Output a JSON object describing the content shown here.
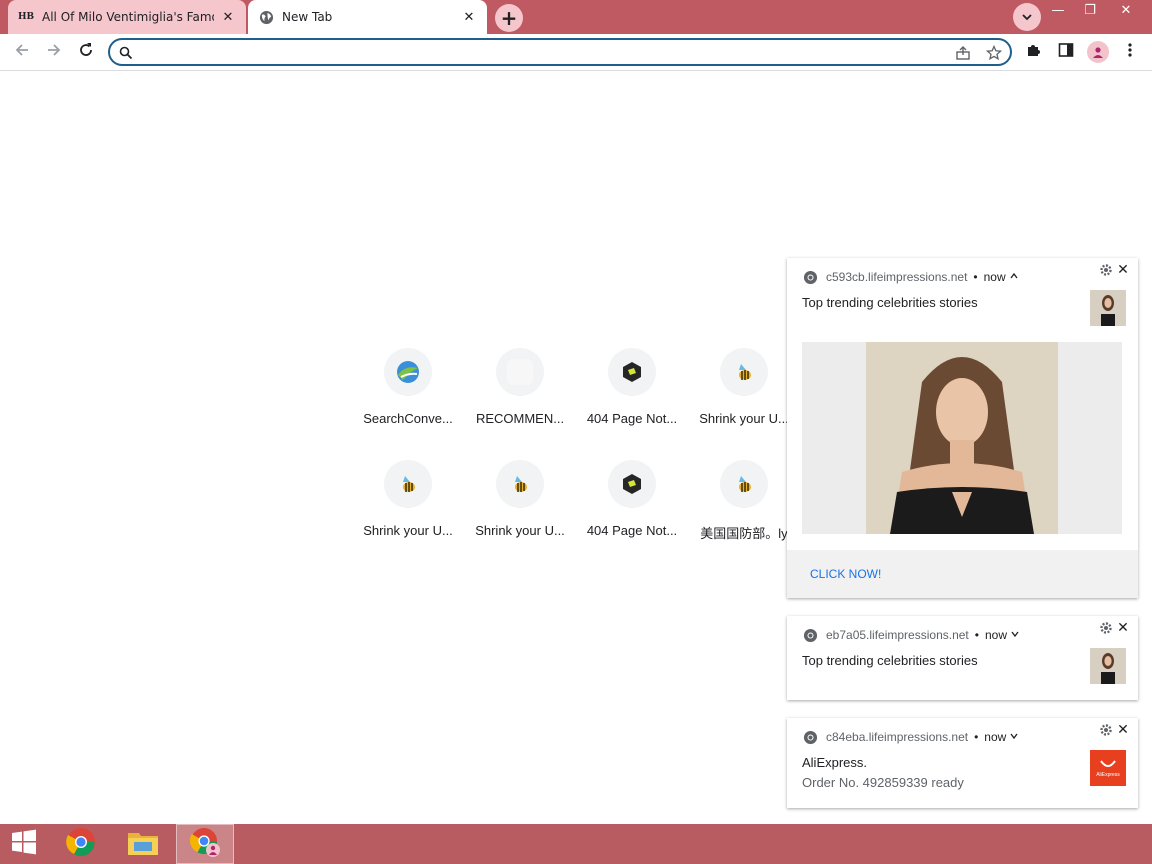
{
  "browser": {
    "tabs": [
      {
        "favicon_text": "HB",
        "title": "All Of Milo Ventimiglia's Famous",
        "close": "✕"
      },
      {
        "favicon_text": "",
        "title": "New Tab",
        "close": "✕"
      }
    ],
    "new_tab": "+",
    "window": {
      "minimize": "—",
      "restore": "❐",
      "close": "✕"
    }
  },
  "toolbar": {
    "omnibox_value": "",
    "omnibox_placeholder": ""
  },
  "shortcuts": [
    {
      "label": "SearchConve...",
      "icon": "search-converter-icon"
    },
    {
      "label": "RECOMMEN...",
      "icon": "blank-site-icon"
    },
    {
      "label": "404 Page Not...",
      "icon": "cube-icon"
    },
    {
      "label": "Shrink your U...",
      "icon": "bee-icon"
    },
    {
      "label": "Shrink your U...",
      "icon": "bee-icon"
    },
    {
      "label": "Shrink your U...",
      "icon": "bee-icon"
    },
    {
      "label": "404 Page Not...",
      "icon": "cube-icon"
    },
    {
      "label": "美国国防部。ly",
      "icon": "bee-icon"
    }
  ],
  "notifications": [
    {
      "site": "c593cb.lifeimpressions.net",
      "dot": "•",
      "time": "now",
      "expanded": true,
      "title": "Top trending celebrities stories",
      "body": "",
      "action": "CLICK NOW!"
    },
    {
      "site": "eb7a05.lifeimpressions.net",
      "dot": "•",
      "time": "now",
      "expanded": false,
      "title": "Top trending celebrities stories",
      "body": ""
    },
    {
      "site": "c84eba.lifeimpressions.net",
      "dot": "•",
      "time": "now",
      "expanded": false,
      "title": "AliExpress.",
      "body": "Order No. 492859339 ready",
      "thumb_text": "AliExpress"
    }
  ],
  "colors": {
    "tabstrip": "#c05a62",
    "active_accent": "#1f5f8b",
    "link": "#1a73e8",
    "taskbar": "#b85c62"
  }
}
